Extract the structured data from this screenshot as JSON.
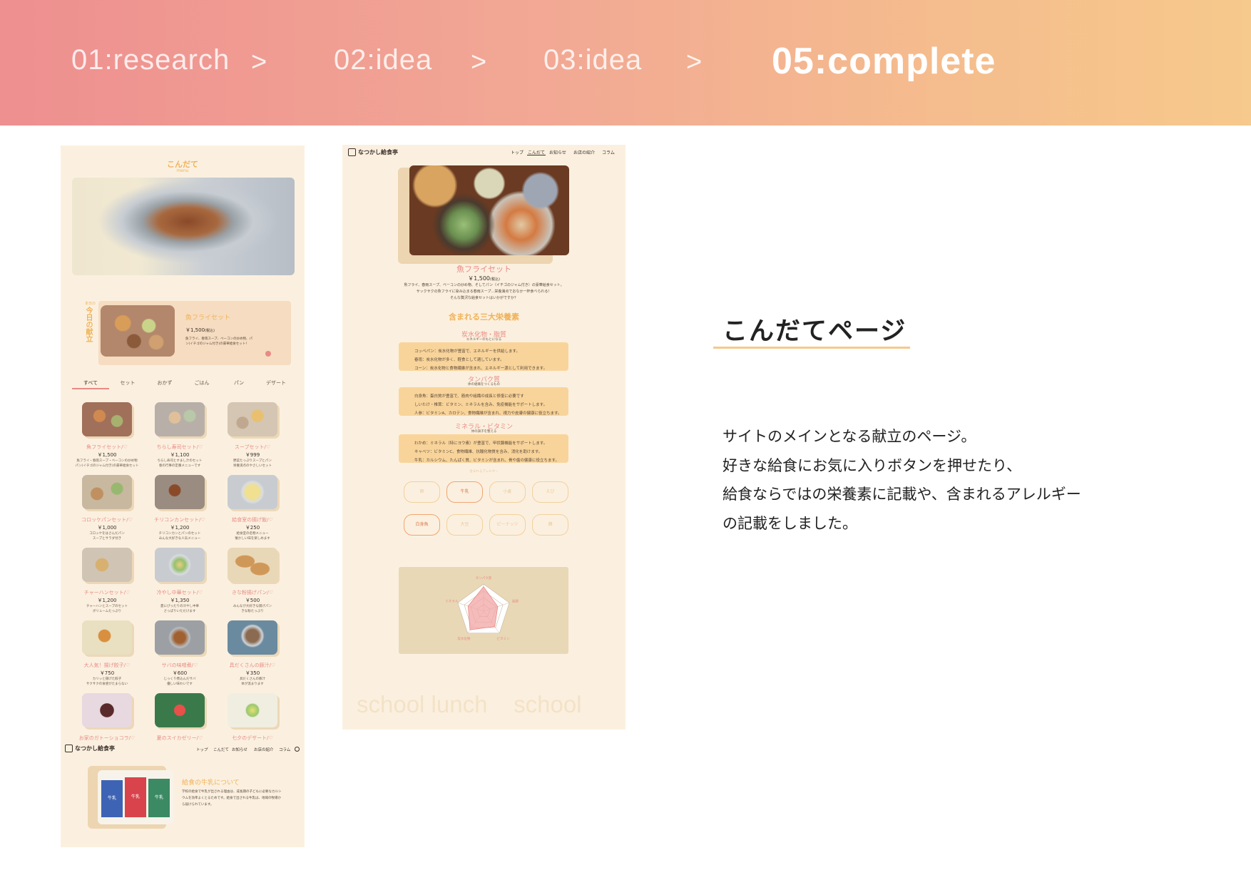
{
  "header": {
    "steps": [
      "01:research",
      "02:idea",
      "03:idea",
      "05:complete"
    ],
    "arrow": ">"
  },
  "mock1": {
    "title": "こんだて",
    "subtitle": "menu",
    "today_label": "今日の献立",
    "today_small": "本日の",
    "featured": {
      "name": "魚フライセット",
      "price": "￥1,500",
      "tax": "(税込)",
      "desc": "魚フライ、春雨スープ、ベーコンの炒め物、パン(イチゴのジャム付き)の豪華給食セット！"
    },
    "tabs": [
      "すべて",
      "セット",
      "おかず",
      "ごはん",
      "パン",
      "デザート"
    ],
    "items": [
      {
        "name": "魚フライセット/♡",
        "price": "￥1,500",
        "desc": "魚フライ・春雨スープ・ベーコンの炒め物\nパン(イチゴのジャム付き)の豪華給食セット"
      },
      {
        "name": "ちらし寿司セット/♡",
        "price": "￥1,100",
        "desc": "ちらし寿司とすまし汁のセット\n春の行事の定番メニューです"
      },
      {
        "name": "スープセット/♡",
        "price": "￥999",
        "desc": "野菜たっぷりスープとパン\n栄養満点のやさしいセット"
      },
      {
        "name": "コロッケパンセット/♡",
        "price": "￥1,000",
        "desc": "コロッケをはさんだパン\nスープとサラダ付き"
      },
      {
        "name": "チリコンカンセット/♡",
        "price": "￥1,200",
        "desc": "チリコンカンとパンのセット\nみんな大好きな人気メニュー"
      },
      {
        "name": "給食室の揚げ飯/♡",
        "price": "￥250",
        "desc": "給食室の名物メニュー\n懐かしい味を楽しめます"
      },
      {
        "name": "チャーハンセット/♡",
        "price": "￥1,200",
        "desc": "チャーハンとスープのセット\nボリュームたっぷり"
      },
      {
        "name": "冷やし中華セット/♡",
        "price": "￥1,350",
        "desc": "夏にぴったりの冷やし中華\nさっぱりいただけます"
      },
      {
        "name": "きな粉揚げパン/♡",
        "price": "￥500",
        "desc": "みんなが大好きな揚げパン\nきな粉たっぷり"
      },
      {
        "name": "大人気！揚げ餃子/♡",
        "price": "￥750",
        "desc": "カリッと揚げた餃子\nサクサクの食感がたまらない"
      },
      {
        "name": "サバの味噌煮/♡",
        "price": "￥600",
        "desc": "じっくり煮込んだサバ\n優しい味わいです"
      },
      {
        "name": "具だくさんの豚汁/♡",
        "price": "￥350",
        "desc": "具だくさんの豚汁\n体が温まります"
      },
      {
        "name": "お家のガトーショコラ/♡",
        "price": "",
        "desc": ""
      },
      {
        "name": "夏のスイカゼリー/♡",
        "price": "",
        "desc": ""
      },
      {
        "name": "七夕のデザート/♡",
        "price": "",
        "desc": ""
      }
    ],
    "footer": {
      "logo": "なつかし給食亭",
      "nav": [
        "トップ",
        "こんだて",
        "お知らせ",
        "お店の紹介",
        "コラム"
      ],
      "milk_title": "給食の牛乳について",
      "milk_text": "学校の給食で牛乳が出される理由は、成長期の子どもに必要なカルシウムを効率よくとるためです。給食で出される牛乳は、地域の牧場から届けられています。",
      "milk_labels": [
        "牛乳",
        "牛乳",
        "牛乳"
      ]
    }
  },
  "mock2": {
    "logo": "なつかし給食亭",
    "nav": [
      "トップ",
      "こんだて",
      "お知らせ",
      "お店の紹介",
      "コラム"
    ],
    "dish": {
      "name": "魚フライセット",
      "price": "￥1,500",
      "tax": "(税込)",
      "desc": "魚フライ、春雨スープ、ベーコンの炒め物、そしてパン（イチゴのジャム付き）の豪華給食セット。\nサックサクの魚フライに染み込まる春雨スープ…栄養満点でおなか一杯食べられる！\nそんな贅沢な給食セットはいかがですか？"
    },
    "nutrition_title": "含まれる三大栄養素",
    "nutrients": [
      {
        "name": "炭水化物・脂質",
        "sub": "エネルギーのもとになる",
        "lines": [
          "コッペパン：炭水化物が豊富で、エネルギーを供給します。",
          "春雨：炭水化物が多く、軽食として適しています。",
          "コーン：炭水化物と食物繊維が含まれ、エネルギー源として利用できます。"
        ]
      },
      {
        "name": "タンパク質",
        "sub": "体の組織をつくるもの",
        "lines": [
          "白身魚：蛋白質が豊富で、筋肉や組織の成長と修復に必要です",
          "しいたけ・椎茸：ビタミン、ミネラルを含み、免疫機能をサポートします。",
          "人参：ビタミンA、カロテン、食物繊維が含まれ、視力や皮膚の健康に役立ちます。"
        ]
      },
      {
        "name": "ミネラル・ビタミン",
        "sub": "体の調子を整える",
        "lines": [
          "わかめ：ミネラル（特にヨウ素）が豊富で、甲状腺機能をサポートします。",
          "キャベツ：ビタミンC、食物繊維、抗酸化物質を含み、消化を助けます。",
          "牛乳：カルシウム、たんぱく質、ビタミンが含まれ、骨や歯の健康に役立ちます。"
        ]
      }
    ],
    "allergy_label": "含まれるアレルギー",
    "allergens": [
      {
        "label": "卵",
        "on": false
      },
      {
        "label": "牛乳",
        "on": true
      },
      {
        "label": "小麦",
        "on": false
      },
      {
        "label": "えび",
        "on": false
      },
      {
        "label": "白身魚",
        "on": true
      },
      {
        "label": "大豆",
        "on": false
      },
      {
        "label": "ピーナッツ",
        "on": false
      },
      {
        "label": "鶏",
        "on": false
      }
    ],
    "radar_labels": [
      "タンパク質",
      "脂質",
      "ビタミン",
      "炭水化物",
      "ミネラル"
    ],
    "watermark": "school lunch    school"
  },
  "right": {
    "title": "こんだてページ",
    "lines": [
      "サイトのメインとなる献立のページ。",
      "好きな給食にお気に入りボタンを押せたり、",
      "給食ならではの栄養素に記載や、含まれるアレルギー",
      "の記載をしました。"
    ]
  },
  "colors": {
    "header_start": "#ee8f90",
    "header_end": "#f6c98c",
    "mock_bg": "#fbf0df",
    "accent_orange": "#f0b25a",
    "accent_pink": "#e98a85",
    "nutrient_box": "#f9d49a"
  }
}
